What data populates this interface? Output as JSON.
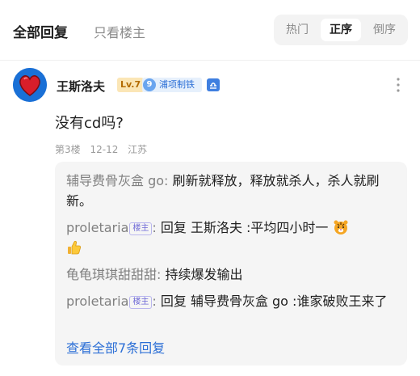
{
  "tabs": {
    "all_replies": "全部回复",
    "op_only": "只看楼主"
  },
  "sort": {
    "hot": "热门",
    "asc": "正序",
    "desc": "倒序",
    "active": "asc"
  },
  "post": {
    "username": "王斯洛夫",
    "level": "Lv.7",
    "member_level": "9",
    "member_title": "浦项制铁",
    "content": "没有cd吗?",
    "floor": "第3楼",
    "date": "12-12",
    "location": "江苏"
  },
  "replies": [
    {
      "name": "辅导费骨灰盒 go",
      "host": "",
      "sep": ":",
      "text": " 刷新就释放，释放就杀人，杀人就刷新。"
    },
    {
      "name": "proletaria",
      "host": "楼主",
      "sep": ":",
      "text": " 回复 王斯洛夫 :平均四小时一",
      "emoji": [
        "tiger-face",
        "thumbs-up"
      ]
    },
    {
      "name": "龟龟琪琪甜甜甜",
      "host": "",
      "sep": ":",
      "text": " 持续爆发输出"
    },
    {
      "name": "proletaria",
      "host": "楼主",
      "sep": ":",
      "text": " 回复 辅导费骨灰盒 go :谁家破败王来了"
    }
  ],
  "view_all": "查看全部7条回复",
  "icons": {
    "avatar": "red-heart-avatar",
    "zodiac": "libra-icon",
    "more": "more-vertical-icon"
  },
  "colors": {
    "link": "#2c6fd6",
    "muted": "#808080",
    "host_tag": "#6f6ad6"
  }
}
